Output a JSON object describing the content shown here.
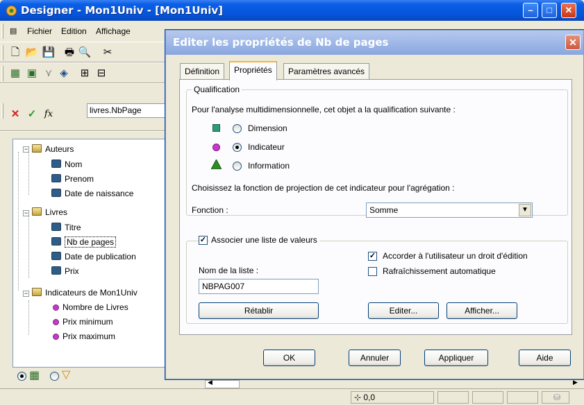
{
  "app": {
    "title": "Designer - Mon1Univ - [Mon1Univ]",
    "menu": [
      "Fichier",
      "Edition",
      "Affichage"
    ],
    "formula_value": "livres.NbPage",
    "status_coords": "0,0"
  },
  "tree": {
    "items": [
      {
        "label": "Auteurs",
        "kind": "folder"
      },
      {
        "label": "Nom",
        "kind": "object"
      },
      {
        "label": "Prenom",
        "kind": "object"
      },
      {
        "label": "Date de naissance",
        "kind": "object"
      },
      {
        "label": "Livres",
        "kind": "folder"
      },
      {
        "label": "Titre",
        "kind": "object"
      },
      {
        "label": "Nb de pages",
        "kind": "object",
        "selected": true
      },
      {
        "label": "Date de publication",
        "kind": "object"
      },
      {
        "label": "Prix",
        "kind": "object"
      },
      {
        "label": "Indicateurs de Mon1Univ",
        "kind": "folder"
      },
      {
        "label": "Nombre de Livres",
        "kind": "indicator"
      },
      {
        "label": "Prix minimum",
        "kind": "indicator"
      },
      {
        "label": "Prix maximum",
        "kind": "indicator"
      }
    ]
  },
  "dialog": {
    "title": "Editer les propriétés de Nb de pages",
    "tabs": [
      "Définition",
      "Propriétés",
      "Paramètres avancés"
    ],
    "active_tab": "Propriétés",
    "qualification": {
      "legend": "Qualification",
      "intro": "Pour l'analyse multidimensionnelle, cet objet a la qualification suivante :",
      "options": [
        "Dimension",
        "Indicateur",
        "Information"
      ],
      "selected": "Indicateur",
      "projection_text": "Choisissez la fonction de projection de cet indicateur pour l'agrégation :",
      "function_label": "Fonction :",
      "function_value": "Somme"
    },
    "lov": {
      "checkbox_label": "Associer une liste de valeurs",
      "checked": true,
      "name_label": "Nom de la liste :",
      "name_value": "NBPAG007",
      "reset_label": "Rétablir",
      "allow_edit_label": "Accorder à l'utilisateur un droit d'édition",
      "allow_edit_checked": true,
      "auto_refresh_label": "Rafraîchissement automatique",
      "auto_refresh_checked": false,
      "edit_label": "Editer...",
      "show_label": "Afficher..."
    },
    "buttons": {
      "ok": "OK",
      "cancel": "Annuler",
      "apply": "Appliquer",
      "help": "Aide"
    }
  }
}
